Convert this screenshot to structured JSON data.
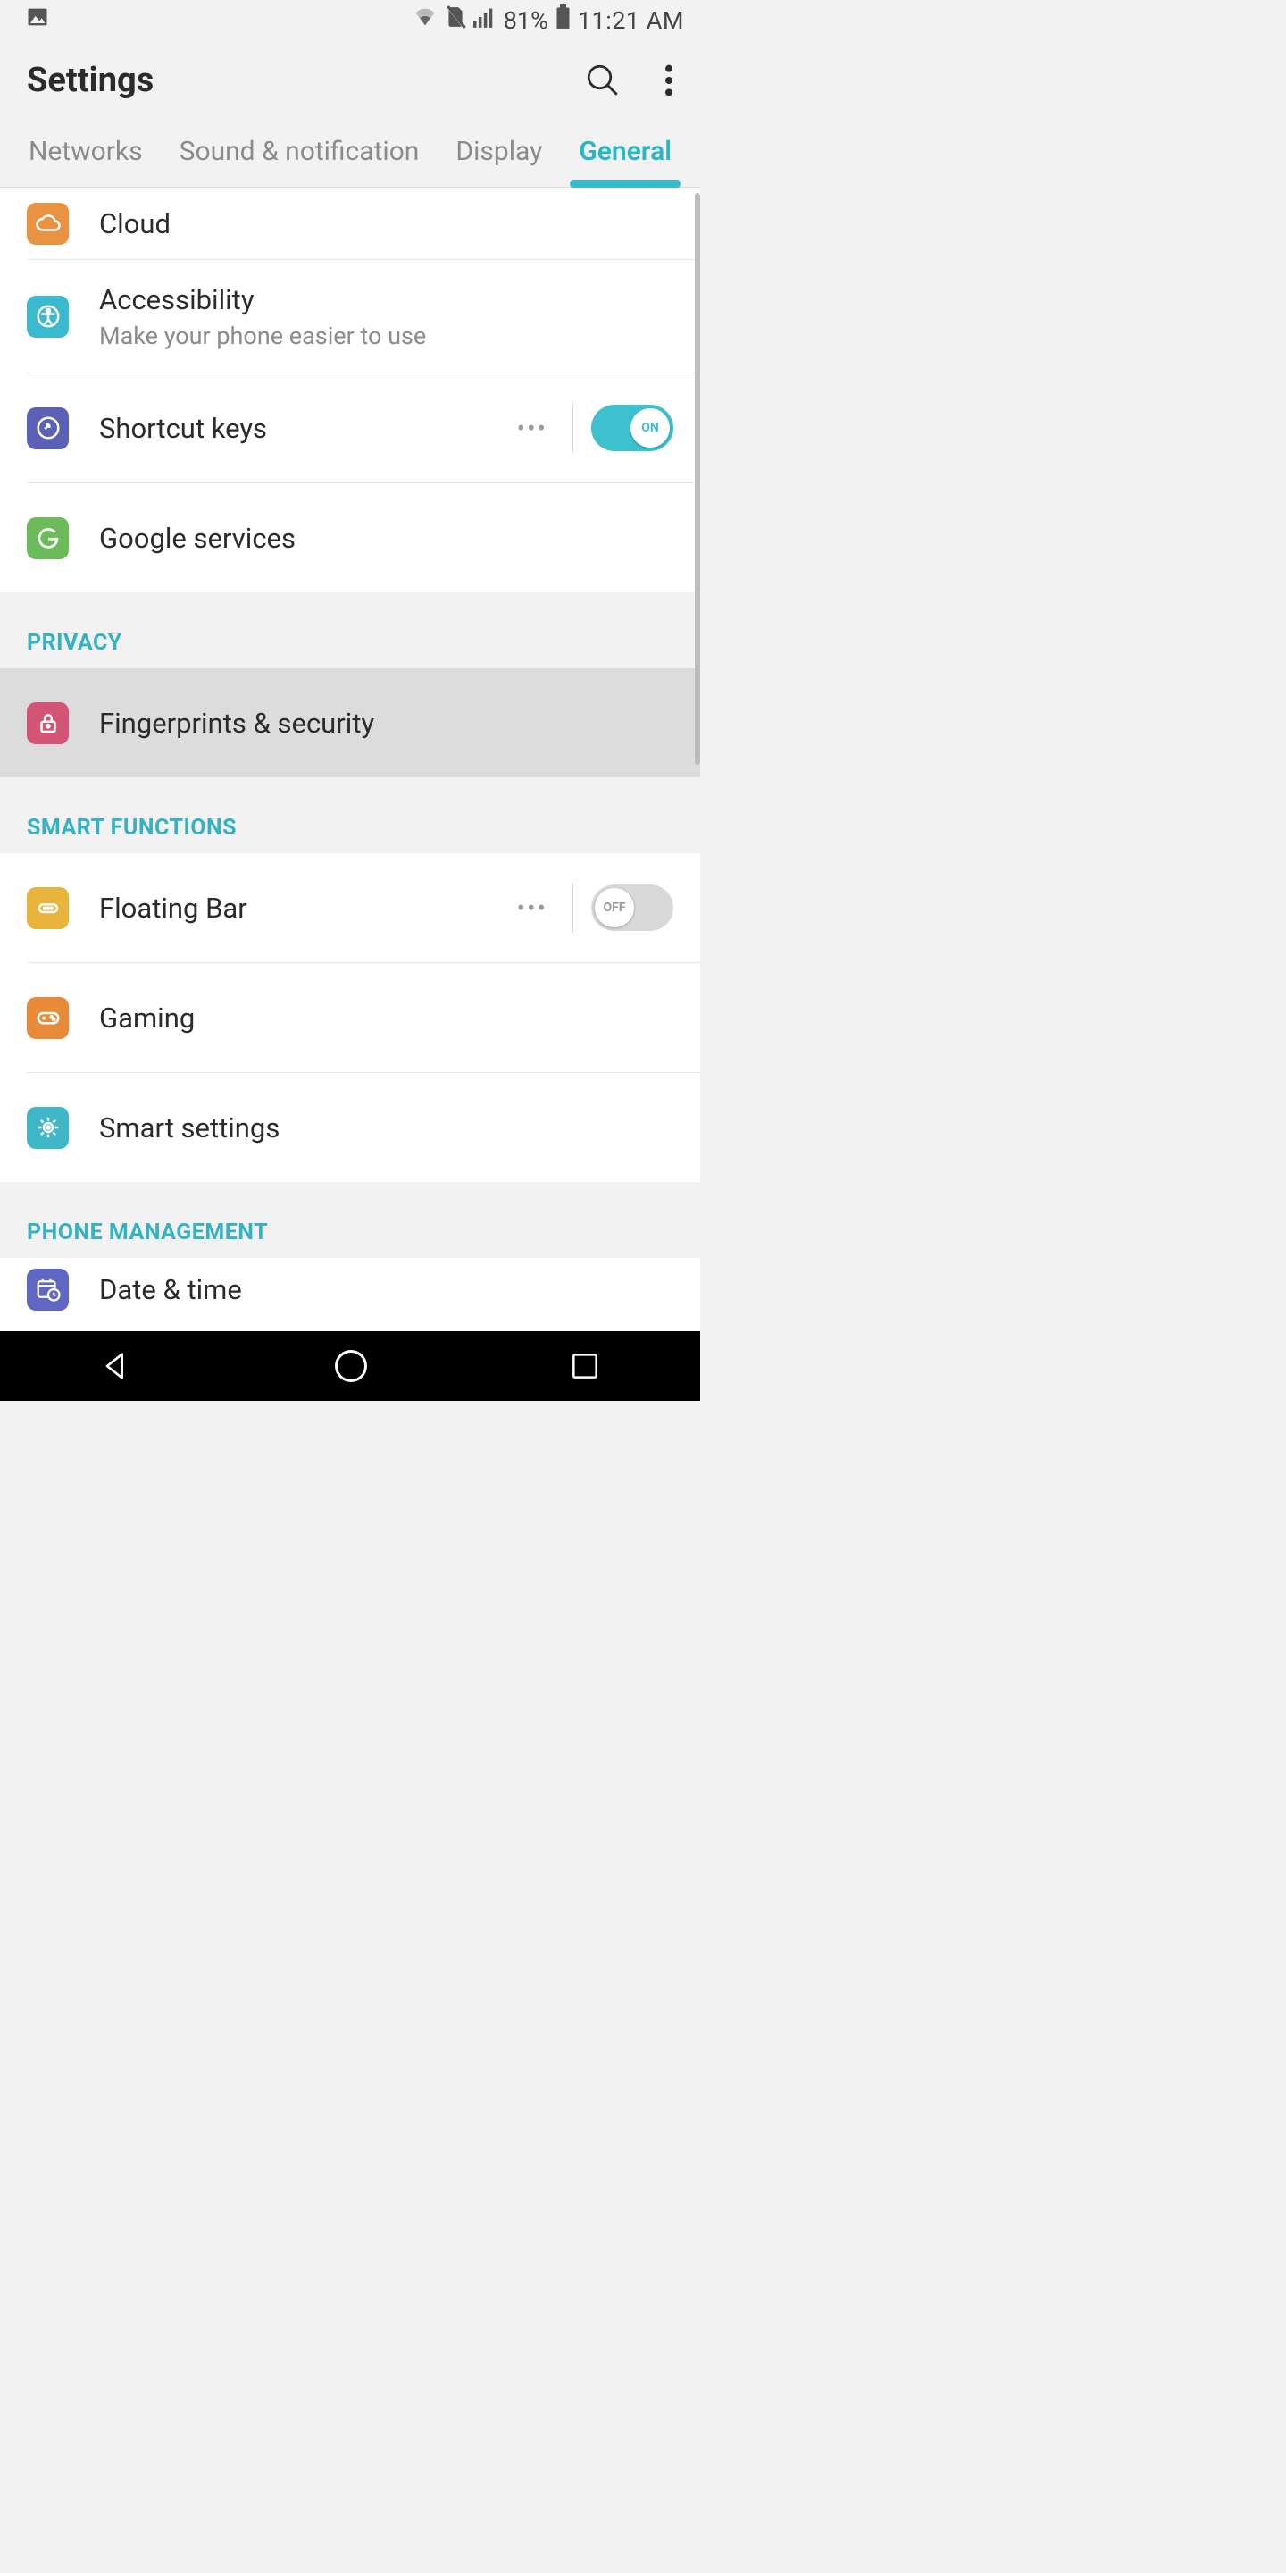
{
  "status": {
    "battery_pct": "81%",
    "time": "11:21 AM"
  },
  "header": {
    "title": "Settings"
  },
  "tabs": [
    {
      "label": "Networks",
      "active": false
    },
    {
      "label": "Sound & notification",
      "active": false
    },
    {
      "label": "Display",
      "active": false
    },
    {
      "label": "General",
      "active": true
    }
  ],
  "rows": {
    "cloud": {
      "title": "Cloud"
    },
    "accessibility": {
      "title": "Accessibility",
      "subtitle": "Make your phone easier to use"
    },
    "shortcut": {
      "title": "Shortcut keys",
      "toggle": "ON"
    },
    "google": {
      "title": "Google services"
    },
    "fingerprints": {
      "title": "Fingerprints & security"
    },
    "floating": {
      "title": "Floating Bar",
      "toggle": "OFF"
    },
    "gaming": {
      "title": "Gaming"
    },
    "smart": {
      "title": "Smart settings"
    },
    "datetime": {
      "title": "Date & time"
    }
  },
  "sections": {
    "privacy": "PRIVACY",
    "smart_functions": "SMART FUNCTIONS",
    "phone_mgmt": "PHONE MANAGEMENT"
  }
}
